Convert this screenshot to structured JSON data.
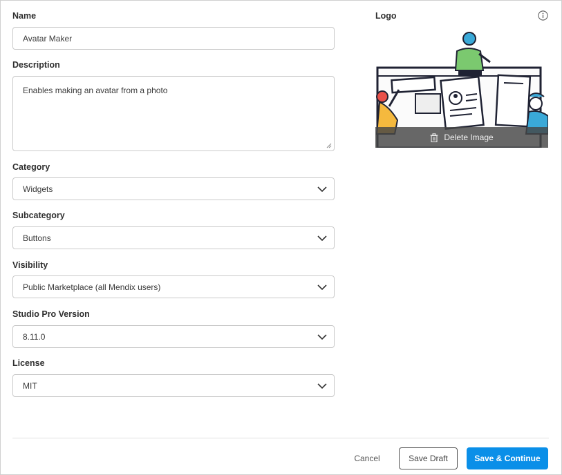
{
  "form": {
    "name_label": "Name",
    "name_value": "Avatar Maker",
    "description_label": "Description",
    "description_value": "Enables making an avatar from a photo",
    "category_label": "Category",
    "category_value": "Widgets",
    "subcategory_label": "Subcategory",
    "subcategory_value": "Buttons",
    "visibility_label": "Visibility",
    "visibility_value": "Public Marketplace (all Mendix users)",
    "studio_label": "Studio Pro Version",
    "studio_value": "8.11.0",
    "license_label": "License",
    "license_value": "MIT"
  },
  "logo": {
    "label": "Logo",
    "delete_label": "Delete Image",
    "info_icon": "info-icon",
    "trash_icon": "trash-icon"
  },
  "footer": {
    "cancel_label": "Cancel",
    "draft_label": "Save Draft",
    "save_label": "Save & Continue"
  },
  "colors": {
    "primary": "#0a8fe8",
    "border": "#c9c9c9"
  }
}
